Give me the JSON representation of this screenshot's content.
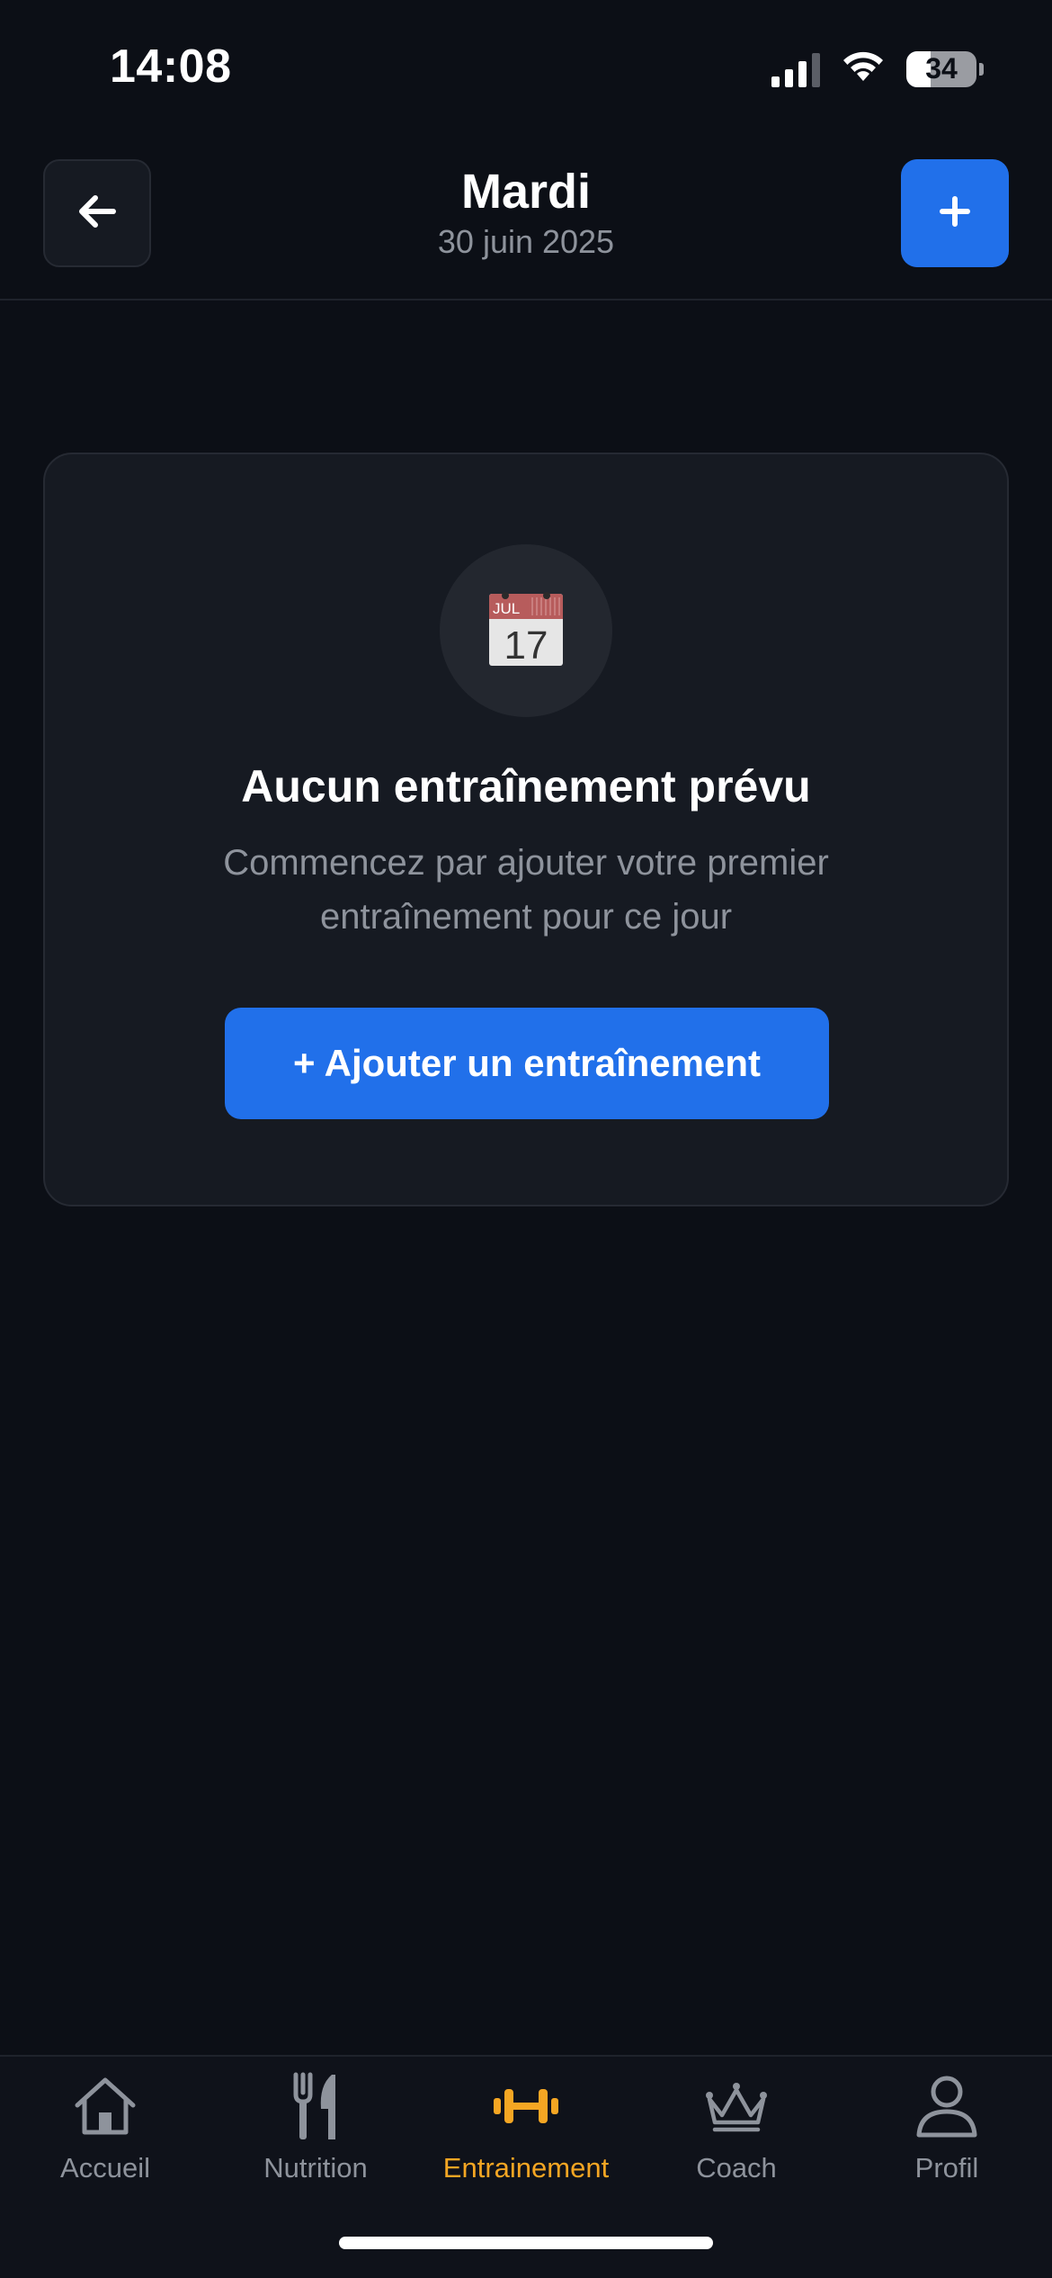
{
  "status_bar": {
    "time": "14:08",
    "battery_level": "34",
    "battery_fraction": 0.34
  },
  "header": {
    "title": "Mardi",
    "date": "30 juin 2025",
    "back_icon": "arrow-left-icon",
    "add_icon": "plus-icon"
  },
  "empty_state": {
    "icon": "calendar-icon",
    "calendar_month": "JUL",
    "calendar_day": "17",
    "title": "Aucun entraînement prévu",
    "subtitle": "Commencez par ajouter votre premier entraînement pour ce jour",
    "cta_label": "+ Ajouter un entraînement"
  },
  "tabbar": {
    "items": [
      {
        "label": "Accueil",
        "icon": "home-icon",
        "active": false
      },
      {
        "label": "Nutrition",
        "icon": "fork-knife-icon",
        "active": false
      },
      {
        "label": "Entrainement",
        "icon": "dumbbell-icon",
        "active": true
      },
      {
        "label": "Coach",
        "icon": "crown-icon",
        "active": false
      },
      {
        "label": "Profil",
        "icon": "user-icon",
        "active": false
      }
    ]
  },
  "colors": {
    "background": "#0c0f16",
    "card": "#161a22",
    "accent_blue": "#2170ea",
    "active_tab": "#f5a623",
    "muted_text": "#8e939c"
  }
}
